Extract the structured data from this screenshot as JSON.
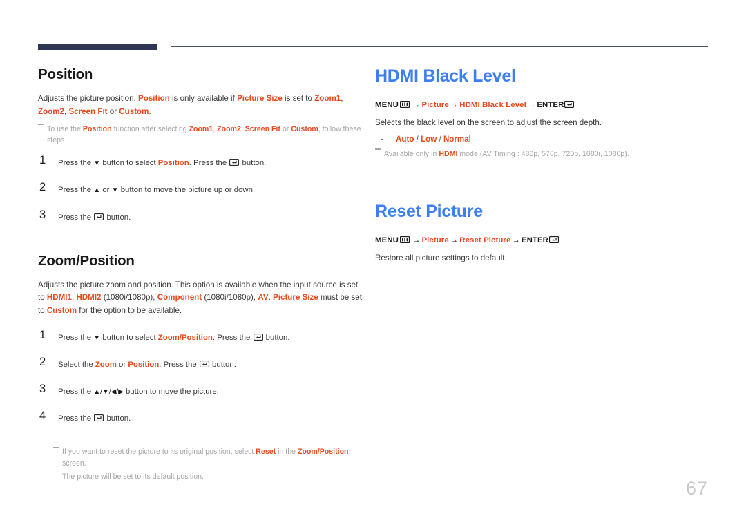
{
  "page": {
    "number": "67",
    "header_rule": {
      "bar_color": "#2e3653",
      "line_color": "#4b4f6b"
    },
    "accent_red": "#e8491d",
    "accent_blue": "#3d7ef0"
  },
  "left_column": {
    "section1": {
      "heading": "Position",
      "intro": {
        "p1_a": "Adjusts the picture position. ",
        "p1_b": "Position",
        "p1_c": " is only available if ",
        "p1_d": "Picture Size",
        "p1_e": " is set to ",
        "p1_f": "Zoom1",
        "p1_g": ", ",
        "p1_h": "Zoom2",
        "p1_i": ", ",
        "p1_j": "Screen Fit",
        "p1_k": " or ",
        "p1_l": "Custom",
        "p1_m": "."
      },
      "note": {
        "a": "To use the ",
        "b": "Position",
        "c": " function after selecting ",
        "d": "Zoom1",
        "e": ", ",
        "f": "Zoom2",
        "g": ", ",
        "h": "Screen Fit",
        "i": " or ",
        "j": "Custom",
        "k": ", follow these steps."
      },
      "steps": [
        {
          "num": "1",
          "a": "Press the ",
          "arrow": "▼",
          "b": " button to select ",
          "c": "Position",
          "d": ". Press the ",
          "e": " button."
        },
        {
          "num": "2",
          "a": "Press the ",
          "arrow": "▲",
          "b": " or ",
          "arrow2": "▼",
          "c": " button to move the picture up or down."
        },
        {
          "num": "3",
          "a": "Press the ",
          "e": " button."
        }
      ]
    },
    "section2": {
      "heading": "Zoom/Position",
      "intro": {
        "a": "Adjusts the picture zoom and position. This option is available when the input source is set to ",
        "b": "HDMI1",
        "c": ", ",
        "d": "HDMI2",
        "e": " (1080i/1080p), ",
        "f": "Component",
        "g": " (1080i/1080p), ",
        "h": "AV",
        "i": ". ",
        "j": "Picture Size",
        "k": " must be set to ",
        "l": "Custom",
        "m": " for the option to be available."
      },
      "steps": [
        {
          "num": "1",
          "a": "Press the ",
          "arrow": "▼",
          "b": " button to select ",
          "c": "Zoom/Position",
          "d": ". Press the ",
          "e": " button."
        },
        {
          "num": "2",
          "a": "Select the ",
          "c": "Zoom",
          "b": " or ",
          "c2": "Position",
          "d": ". Press the ",
          "e": " button."
        },
        {
          "num": "3",
          "a": "Press the ",
          "arrows": "▲/▼/◀/▶",
          "c": " button to move the picture."
        },
        {
          "num": "4",
          "a": "Press the ",
          "e": " button."
        }
      ],
      "notes": [
        {
          "a": "If you want to reset the picture to its original position, select ",
          "b": "Reset",
          "c": " in the ",
          "d": "Zoom/Position",
          "e": " screen."
        },
        {
          "a": "The picture will be set to its default position.",
          "b": "",
          "c": "",
          "d": "",
          "e": ""
        }
      ]
    }
  },
  "right_column": {
    "section1": {
      "heading": "HDMI Black Level",
      "menupath": {
        "menu_label": "MENU",
        "item1": "Picture",
        "item2": "HDMI Black Level",
        "enter_label": "ENTER",
        "arrow": "→"
      },
      "description": "Selects the black level on the screen to adjust the screen depth.",
      "bullet": {
        "opt1": "Auto",
        "sep1": " / ",
        "opt2": "Low",
        "sep2": " / ",
        "opt3": "Normal"
      },
      "note": {
        "a": "Available only in ",
        "b": "HDMI",
        "c": " mode (AV Timing : 480p, 576p, 720p, 1080i, 1080p)."
      }
    },
    "section2": {
      "heading": "Reset Picture",
      "menupath": {
        "menu_label": "MENU",
        "item1": "Picture",
        "item2": "Reset Picture",
        "enter_label": "ENTER",
        "arrow": "→"
      },
      "description": "Restore all picture settings to default."
    }
  }
}
